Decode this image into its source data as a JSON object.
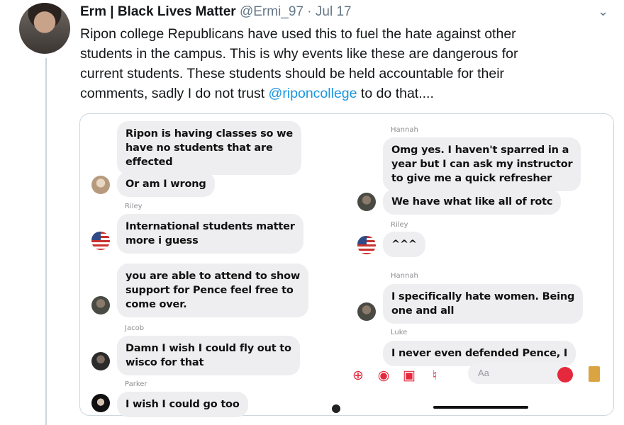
{
  "tweet": {
    "display_name": "Erm | Black Lives Matter",
    "handle": "@Ermi_97",
    "separator": "·",
    "date": "Jul 17",
    "text_lines": [
      "Ripon college Republicans have used this to fuel the hate against other",
      "students in the campus. This is why events like these are dangerous for",
      "current students. These students should be held accountable for their"
    ],
    "last_line_prefix": "comments, sadly I do not trust ",
    "mention": "@riponcollege",
    "last_line_suffix": " to do that...."
  },
  "chat_left": [
    {
      "sender": "",
      "text": [
        "Ripon is having classes so we",
        "have no students that are",
        "effected"
      ]
    },
    {
      "sender": "",
      "text": [
        "Or am I wrong"
      ]
    },
    {
      "sender": "Riley",
      "text": [
        "International students matter",
        "more i guess"
      ]
    },
    {
      "sender": "Jacob",
      "text": [
        "you are able to attend to show",
        "support for Pence feel free to",
        "come over."
      ]
    },
    {
      "sender": "Jacob",
      "text": [
        "Damn I wish I could fly out to",
        "wisco for that"
      ]
    },
    {
      "sender": "Parker",
      "text": [
        "I wish I could go too"
      ]
    }
  ],
  "chat_right": [
    {
      "sender": "Hannah",
      "text": [
        "Omg yes. I haven't sparred in a",
        "year but I can ask my instructor",
        "to give me a quick refresher"
      ]
    },
    {
      "sender": "",
      "text": [
        "We have what like all of rotc"
      ]
    },
    {
      "sender": "Riley",
      "text": [
        "^^^"
      ]
    },
    {
      "sender": "Hannah",
      "text": [
        "I specifically hate women. Being",
        "one and all"
      ]
    },
    {
      "sender": "Luke",
      "text": [
        "I never even defended Pence, I"
      ]
    }
  ],
  "composer": {
    "placeholder": "Aa"
  },
  "accent_colors": {
    "mention": "#1b95e0",
    "messenger_red": "#e6283c"
  }
}
